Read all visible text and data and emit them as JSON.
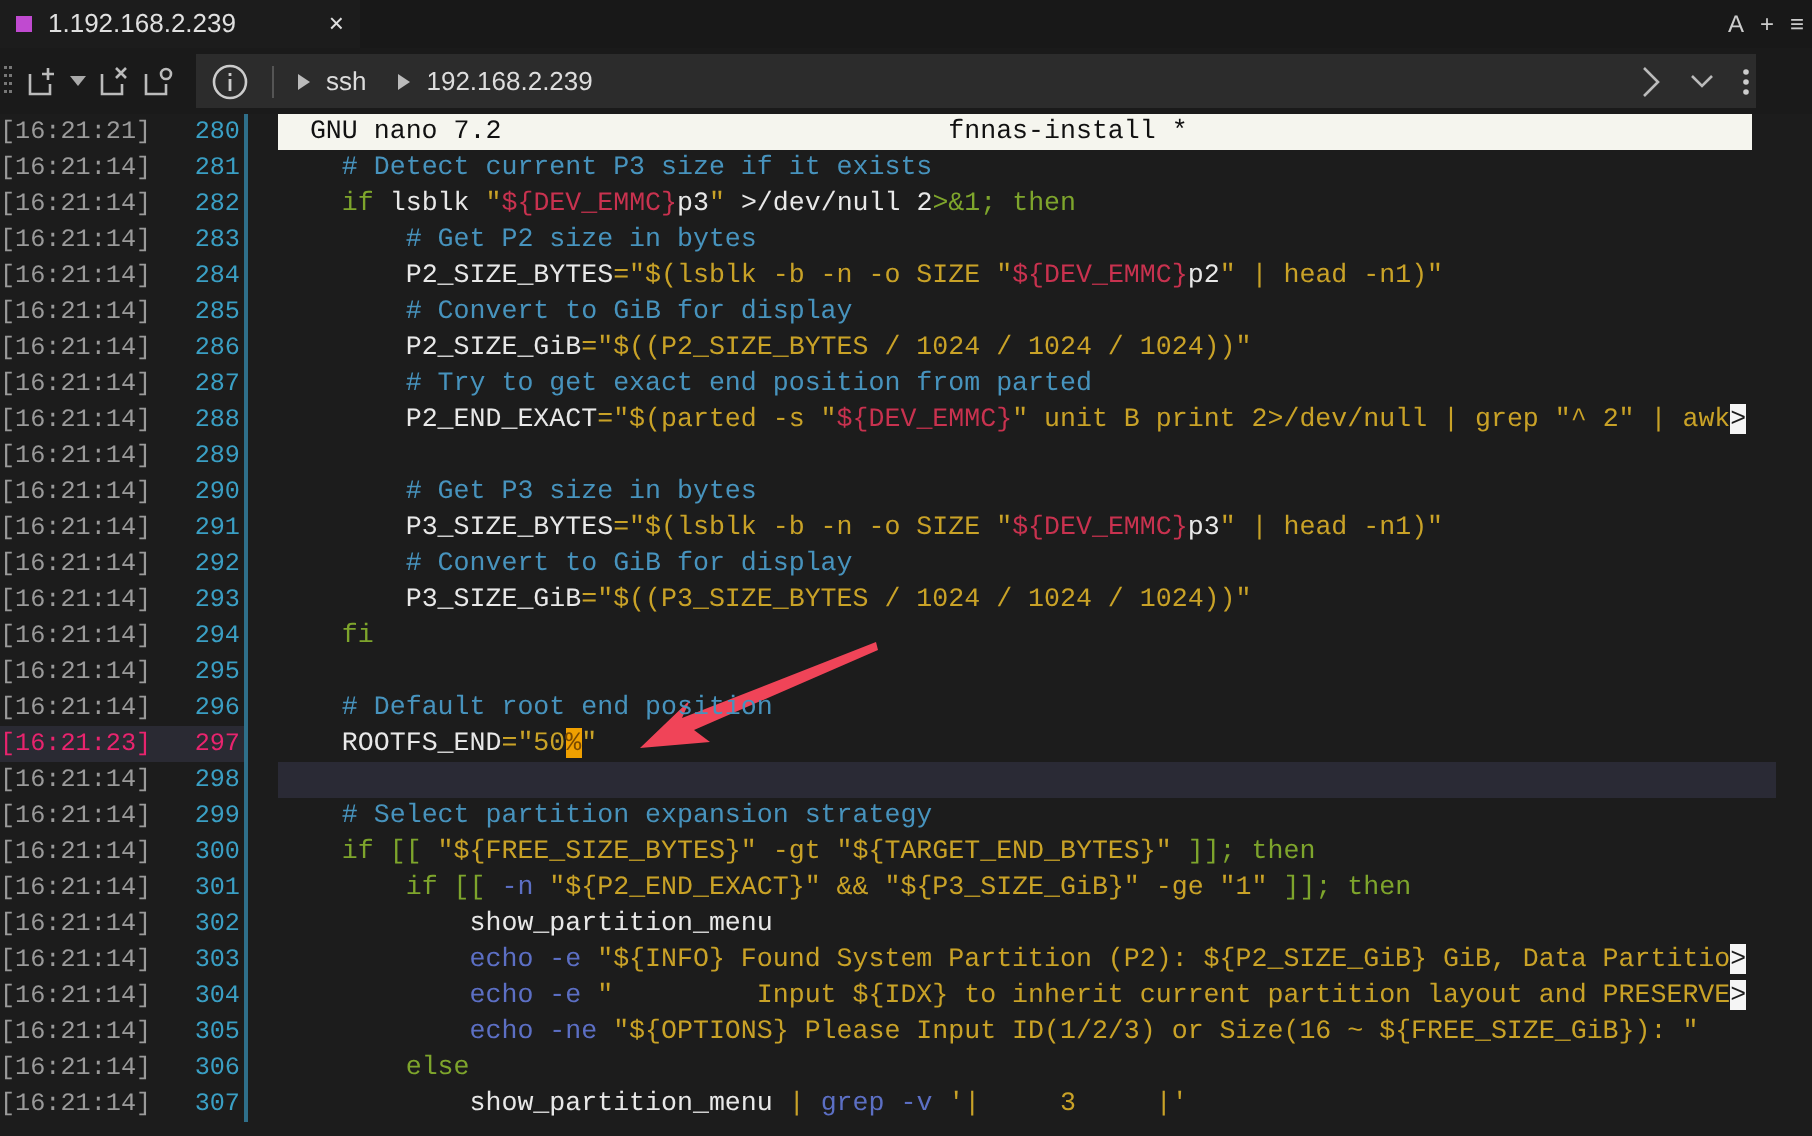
{
  "tab": {
    "title": "1.192.168.2.239",
    "close": "×",
    "selected": true
  },
  "tab_bar_actions": [
    "A",
    "+",
    "≡"
  ],
  "address": {
    "segments": [
      "ssh",
      "192.168.2.239"
    ]
  },
  "terminal": {
    "lines": [
      {
        "time": "[16:21:21]",
        "number": "280",
        "selected": false,
        "kind": "nano_title",
        "left": "GNU nano 7.2",
        "center": "fnnas-install *"
      },
      {
        "time": "[16:21:14]",
        "number": "281",
        "selected": false,
        "cursor_line": false,
        "kind": "code",
        "tokens": [
          {
            "text": "    # Detect current P3 size if it exists",
            "kind": "comment"
          }
        ]
      },
      {
        "time": "[16:21:14]",
        "number": "282",
        "selected": false,
        "cursor_line": false,
        "kind": "code",
        "tokens": [
          {
            "text": "    if",
            "kind": "keyword"
          },
          {
            "text": " lsblk ",
            "kind": "plain"
          },
          {
            "text": "\"",
            "kind": "string"
          },
          {
            "text": "${DEV_EMMC}",
            "kind": "var"
          },
          {
            "text": "p3",
            "kind": "plain"
          },
          {
            "text": "\"",
            "kind": "string"
          },
          {
            "text": " >/dev/null 2",
            "kind": "plain"
          },
          {
            "text": ">&1; then",
            "kind": "keyword"
          }
        ]
      },
      {
        "time": "[16:21:14]",
        "number": "283",
        "selected": false,
        "cursor_line": false,
        "kind": "code",
        "tokens": [
          {
            "text": "        # Get P2 size in bytes",
            "kind": "comment"
          }
        ]
      },
      {
        "time": "[16:21:14]",
        "number": "284",
        "selected": false,
        "cursor_line": false,
        "kind": "code",
        "tokens": [
          {
            "text": "        P2_SIZE_BYTES",
            "kind": "plain"
          },
          {
            "text": "=\"$(lsblk -b -n -o SIZE \"",
            "kind": "string"
          },
          {
            "text": "${DEV_EMMC}",
            "kind": "var"
          },
          {
            "text": "p2",
            "kind": "plain"
          },
          {
            "text": "\" | head -n1)\"",
            "kind": "string"
          }
        ]
      },
      {
        "time": "[16:21:14]",
        "number": "285",
        "selected": false,
        "cursor_line": false,
        "kind": "code",
        "tokens": [
          {
            "text": "        # Convert to GiB for display",
            "kind": "comment"
          }
        ]
      },
      {
        "time": "[16:21:14]",
        "number": "286",
        "selected": false,
        "cursor_line": false,
        "kind": "code",
        "tokens": [
          {
            "text": "        P2_SIZE_GiB",
            "kind": "plain"
          },
          {
            "text": "=\"$((P2_SIZE_BYTES / 1024 / 1024 / 1024))\"",
            "kind": "string"
          }
        ]
      },
      {
        "time": "[16:21:14]",
        "number": "287",
        "selected": false,
        "cursor_line": false,
        "kind": "code",
        "tokens": [
          {
            "text": "        # Try to get exact end position from parted",
            "kind": "comment"
          }
        ]
      },
      {
        "time": "[16:21:14]",
        "number": "288",
        "selected": false,
        "cursor_line": false,
        "kind": "code",
        "tokens": [
          {
            "text": "        P2_END_EXACT",
            "kind": "plain"
          },
          {
            "text": "=\"$(parted -s \"",
            "kind": "string"
          },
          {
            "text": "${DEV_EMMC}",
            "kind": "var"
          },
          {
            "text": "\" unit B print 2>/dev/null | grep \"^ 2\" | awk",
            "kind": "string"
          },
          {
            "text": ">",
            "kind": "overflow"
          }
        ]
      },
      {
        "time": "[16:21:14]",
        "number": "289",
        "selected": false,
        "cursor_line": false,
        "kind": "code"
      },
      {
        "time": "[16:21:14]",
        "number": "290",
        "selected": false,
        "cursor_line": false,
        "kind": "code",
        "tokens": [
          {
            "text": "        # Get P3 size in bytes",
            "kind": "comment"
          }
        ]
      },
      {
        "time": "[16:21:14]",
        "number": "291",
        "selected": false,
        "cursor_line": false,
        "kind": "code",
        "tokens": [
          {
            "text": "        P3_SIZE_BYTES",
            "kind": "plain"
          },
          {
            "text": "=\"$(lsblk -b -n -o SIZE \"",
            "kind": "string"
          },
          {
            "text": "${DEV_EMMC}",
            "kind": "var"
          },
          {
            "text": "p3",
            "kind": "plain"
          },
          {
            "text": "\" | head -n1)\"",
            "kind": "string"
          }
        ]
      },
      {
        "time": "[16:21:14]",
        "number": "292",
        "selected": false,
        "cursor_line": false,
        "kind": "code",
        "tokens": [
          {
            "text": "        # Convert to GiB for display",
            "kind": "comment"
          }
        ]
      },
      {
        "time": "[16:21:14]",
        "number": "293",
        "selected": false,
        "cursor_line": false,
        "kind": "code",
        "tokens": [
          {
            "text": "        P3_SIZE_GiB",
            "kind": "plain"
          },
          {
            "text": "=\"$((P3_SIZE_BYTES / 1024 / 1024 / 1024))\"",
            "kind": "string"
          }
        ]
      },
      {
        "time": "[16:21:14]",
        "number": "294",
        "selected": false,
        "cursor_line": false,
        "kind": "code",
        "tokens": [
          {
            "text": "    fi",
            "kind": "keyword"
          }
        ]
      },
      {
        "time": "[16:21:14]",
        "number": "295",
        "selected": false,
        "cursor_line": false,
        "kind": "code"
      },
      {
        "time": "[16:21:14]",
        "number": "296",
        "selected": false,
        "cursor_line": false,
        "kind": "code",
        "tokens": [
          {
            "text": "    # Default root end position",
            "kind": "comment"
          }
        ]
      },
      {
        "time": "[16:21:23]",
        "number": "297",
        "selected": true,
        "cursor_line": false,
        "kind": "code",
        "tokens": [
          {
            "text": "    ROOTFS_END",
            "kind": "plain"
          },
          {
            "text": "=\"50",
            "kind": "string"
          },
          {
            "text": "%",
            "kind": "cursor"
          },
          {
            "text": "\"",
            "kind": "string"
          }
        ]
      },
      {
        "time": "[16:21:14]",
        "number": "298",
        "selected": false,
        "cursor_line": true,
        "kind": "code"
      },
      {
        "time": "[16:21:14]",
        "number": "299",
        "selected": false,
        "cursor_line": false,
        "kind": "code",
        "tokens": [
          {
            "text": "    # Select partition expansion strategy",
            "kind": "comment"
          }
        ]
      },
      {
        "time": "[16:21:14]",
        "number": "300",
        "selected": false,
        "cursor_line": false,
        "kind": "code",
        "tokens": [
          {
            "text": "    if [[ ",
            "kind": "keyword"
          },
          {
            "text": "\"${FREE_SIZE_BYTES}\" -gt \"${TARGET_END_BYTES}\"",
            "kind": "string"
          },
          {
            "text": " ]]; then",
            "kind": "keyword"
          }
        ]
      },
      {
        "time": "[16:21:14]",
        "number": "301",
        "selected": false,
        "cursor_line": false,
        "kind": "code",
        "tokens": [
          {
            "text": "        if [[ ",
            "kind": "keyword"
          },
          {
            "text": "-n",
            "kind": "flag"
          },
          {
            "text": " \"${P2_END_EXACT}\" && \"${P3_SIZE_GiB}\" -ge \"1\"",
            "kind": "string"
          },
          {
            "text": " ]]; then",
            "kind": "keyword"
          }
        ]
      },
      {
        "time": "[16:21:14]",
        "number": "302",
        "selected": false,
        "cursor_line": false,
        "kind": "code",
        "tokens": [
          {
            "text": "            show_partition_menu",
            "kind": "plain"
          }
        ]
      },
      {
        "time": "[16:21:14]",
        "number": "303",
        "selected": false,
        "cursor_line": false,
        "kind": "code",
        "tokens": [
          {
            "text": "            echo -e",
            "kind": "flag"
          },
          {
            "text": " \"${INFO} Found System Partition (P2): ${P2_SIZE_GiB} GiB, Data Partitio",
            "kind": "string"
          },
          {
            "text": ">",
            "kind": "overflow"
          }
        ]
      },
      {
        "time": "[16:21:14]",
        "number": "304",
        "selected": false,
        "cursor_line": false,
        "kind": "code",
        "tokens": [
          {
            "text": "            echo -e",
            "kind": "flag"
          },
          {
            "text": " \"         Input ${IDX} to inherit current partition layout and PRESERVE",
            "kind": "string"
          },
          {
            "text": ">",
            "kind": "overflow"
          }
        ]
      },
      {
        "time": "[16:21:14]",
        "number": "305",
        "selected": false,
        "cursor_line": false,
        "kind": "code",
        "tokens": [
          {
            "text": "            echo -ne",
            "kind": "flag"
          },
          {
            "text": " \"${OPTIONS} Please Input ID(1/2/3) or Size(16 ~ ${FREE_SIZE_GiB}): \"",
            "kind": "string"
          }
        ]
      },
      {
        "time": "[16:21:14]",
        "number": "306",
        "selected": false,
        "cursor_line": false,
        "kind": "code",
        "tokens": [
          {
            "text": "        else",
            "kind": "keyword"
          }
        ]
      },
      {
        "time": "[16:21:14]",
        "number": "307",
        "selected": false,
        "cursor_line": false,
        "kind": "code",
        "tokens": [
          {
            "text": "            show_partition_menu",
            "kind": "plain"
          },
          {
            "text": " | ",
            "kind": "string"
          },
          {
            "text": "grep -v",
            "kind": "flag"
          },
          {
            "text": " '|     3     |'",
            "kind": "string"
          }
        ]
      }
    ]
  }
}
